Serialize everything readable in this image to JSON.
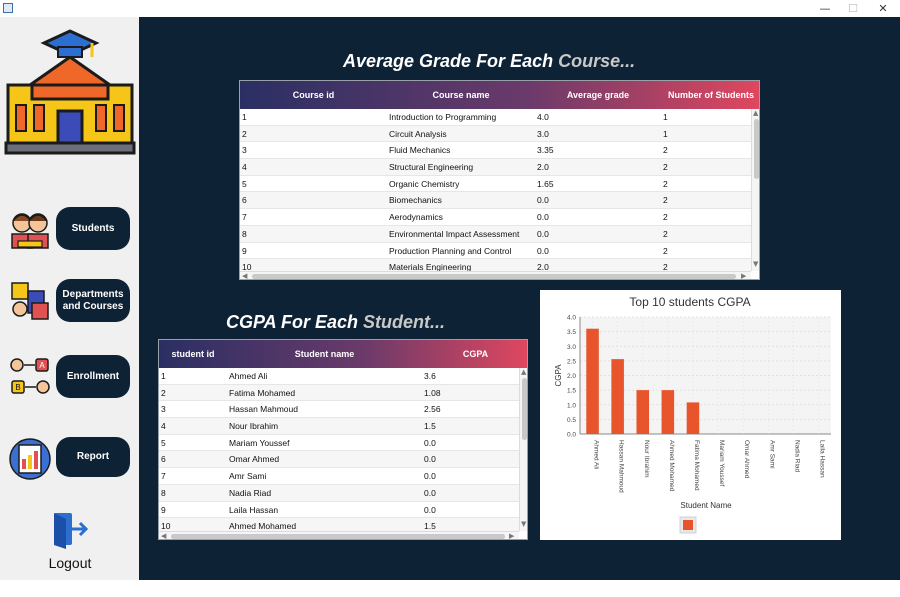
{
  "window": {
    "minimize": "—",
    "maximize": "☐",
    "close": "✕"
  },
  "nav": {
    "students": "Students",
    "departments_courses": "Departments and Courses",
    "enrollment": "Enrollment",
    "report": "Report",
    "logout": "Logout"
  },
  "course_section": {
    "title_main": "Average Grade For Each ",
    "title_fade": "Course...",
    "columns": [
      "Course id",
      "Course name",
      "Average grade",
      "Number of Students"
    ],
    "rows": [
      [
        "1",
        "Introduction to Programming",
        "4.0",
        "1"
      ],
      [
        "2",
        "Circuit Analysis",
        "3.0",
        "1"
      ],
      [
        "3",
        "Fluid Mechanics",
        "3.35",
        "2"
      ],
      [
        "4",
        "Structural Engineering",
        "2.0",
        "2"
      ],
      [
        "5",
        "Organic Chemistry",
        "1.65",
        "2"
      ],
      [
        "6",
        "Biomechanics",
        "0.0",
        "2"
      ],
      [
        "7",
        "Aerodynamics",
        "0.0",
        "2"
      ],
      [
        "8",
        "Environmental Impact Assessment",
        "0.0",
        "2"
      ],
      [
        "9",
        "Production Planning and Control",
        "0.0",
        "2"
      ],
      [
        "10",
        "Materials Engineering",
        "2.0",
        "2"
      ]
    ]
  },
  "student_section": {
    "title_main": "CGPA For Each ",
    "title_fade": "Student...",
    "columns": [
      "student id",
      "Student name",
      "CGPA"
    ],
    "rows": [
      [
        "1",
        "Ahmed Ali",
        "3.6"
      ],
      [
        "2",
        "Fatima Mohamed",
        "1.08"
      ],
      [
        "3",
        "Hassan Mahmoud",
        "2.56"
      ],
      [
        "4",
        "Nour Ibrahim",
        "1.5"
      ],
      [
        "5",
        "Mariam Youssef",
        "0.0"
      ],
      [
        "6",
        "Omar Ahmed",
        "0.0"
      ],
      [
        "7",
        "Amr Sami",
        "0.0"
      ],
      [
        "8",
        "Nadia Riad",
        "0.0"
      ],
      [
        "9",
        "Laila Hassan",
        "0.0"
      ],
      [
        "10",
        "Ahmed Mohamed",
        "1.5"
      ]
    ]
  },
  "chart_data": {
    "type": "bar",
    "title": "Top 10 students CGPA",
    "xlabel": "Student Name",
    "ylabel": "CGPA",
    "categories": [
      "Ahmed Ali",
      "Hassan Mahmoud",
      "Nour Ibrahim",
      "Ahmed Mohamed",
      "Fatima Mohamed",
      "Mariam Youssef",
      "Omar Ahmed",
      "Amr Sami",
      "Nadia Riad",
      "Laila Hassan"
    ],
    "values": [
      3.6,
      2.56,
      1.5,
      1.5,
      1.08,
      0.0,
      0.0,
      0.0,
      0.0,
      0.0
    ],
    "ylim": [
      0,
      4.0
    ],
    "yticks": [
      "0.0",
      "0.5",
      "1.0",
      "1.5",
      "2.0",
      "2.5",
      "3.0",
      "3.5",
      "4.0"
    ],
    "grid": true,
    "bar_color": "#e8552d",
    "legend_placement": "bottom"
  }
}
